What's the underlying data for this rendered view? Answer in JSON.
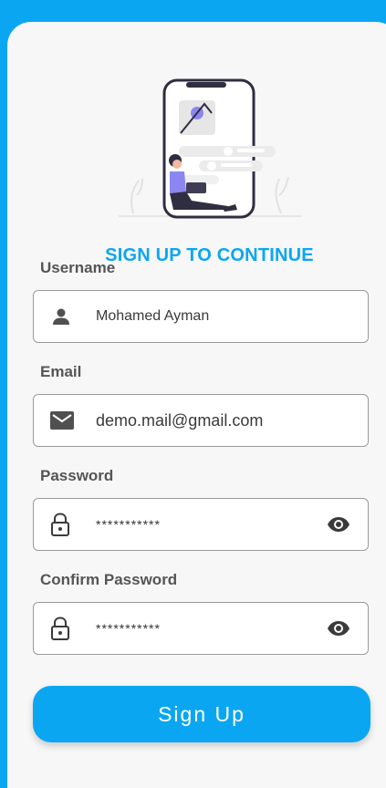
{
  "title": "SIGN UP TO CONTINUE",
  "form": {
    "username": {
      "label": "Username",
      "value": "Mohamed Ayman",
      "icon": "person-icon"
    },
    "email": {
      "label": "Email",
      "value": "demo.mail@gmail.com",
      "icon": "mail-icon"
    },
    "password": {
      "label": "Password",
      "value": "***********",
      "icon": "lock-icon",
      "toggle_icon": "eye-icon"
    },
    "confirm_password": {
      "label": "Confirm Password",
      "value": "***********",
      "icon": "lock-icon",
      "toggle_icon": "eye-icon"
    }
  },
  "submit_label": "Sign Up",
  "colors": {
    "accent": "#0aa6f2",
    "card": "#f7f7f8",
    "label": "#555555"
  }
}
